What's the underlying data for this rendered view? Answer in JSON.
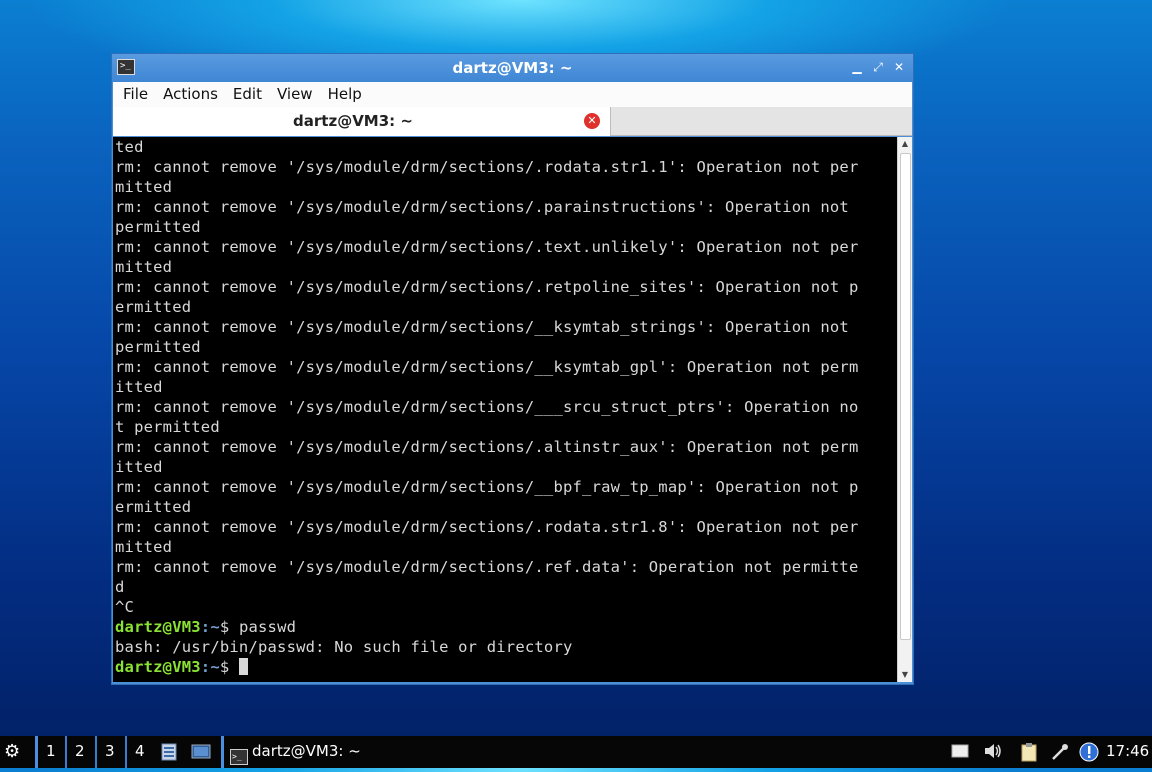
{
  "window": {
    "title": "dartz@VM3: ~",
    "controls": {
      "minimize": "▁",
      "maximize": "⤢",
      "close": "✕"
    }
  },
  "menubar": {
    "items": [
      "File",
      "Actions",
      "Edit",
      "View",
      "Help"
    ]
  },
  "tab": {
    "label": "dartz@VM3: ~",
    "close_icon": "close-circle-icon"
  },
  "terminal": {
    "lines": [
      "ted",
      "rm: cannot remove '/sys/module/drm/sections/.rodata.str1.1': Operation not per",
      "mitted",
      "rm: cannot remove '/sys/module/drm/sections/.parainstructions': Operation not ",
      "permitted",
      "rm: cannot remove '/sys/module/drm/sections/.text.unlikely': Operation not per",
      "mitted",
      "rm: cannot remove '/sys/module/drm/sections/.retpoline_sites': Operation not p",
      "ermitted",
      "rm: cannot remove '/sys/module/drm/sections/__ksymtab_strings': Operation not ",
      "permitted",
      "rm: cannot remove '/sys/module/drm/sections/__ksymtab_gpl': Operation not perm",
      "itted",
      "rm: cannot remove '/sys/module/drm/sections/___srcu_struct_ptrs': Operation no",
      "t permitted",
      "rm: cannot remove '/sys/module/drm/sections/.altinstr_aux': Operation not perm",
      "itted",
      "rm: cannot remove '/sys/module/drm/sections/__bpf_raw_tp_map': Operation not p",
      "ermitted",
      "rm: cannot remove '/sys/module/drm/sections/.rodata.str1.8': Operation not per",
      "mitted",
      "rm: cannot remove '/sys/module/drm/sections/.ref.data': Operation not permitte",
      "d",
      "^C"
    ],
    "prompt_user": "dartz@VM3",
    "prompt_path": ":~",
    "prompt_symbol": "$ ",
    "command": "passwd",
    "error": "bash: /usr/bin/passwd: No such file or directory"
  },
  "taskbar": {
    "start_icon": "start-menu-icon",
    "workspaces": [
      "1",
      "2",
      "3",
      "4"
    ],
    "task_label": "dartz@VM3: ~",
    "clock": "17:46",
    "tray_icons": [
      "notification-icon",
      "volume-icon",
      "clipboard-icon",
      "network-icon",
      "update-icon"
    ]
  },
  "colors": {
    "prompt_user": "#8ae234",
    "prompt_path": "#729fcf",
    "window_accent": "#4b8fd6"
  }
}
